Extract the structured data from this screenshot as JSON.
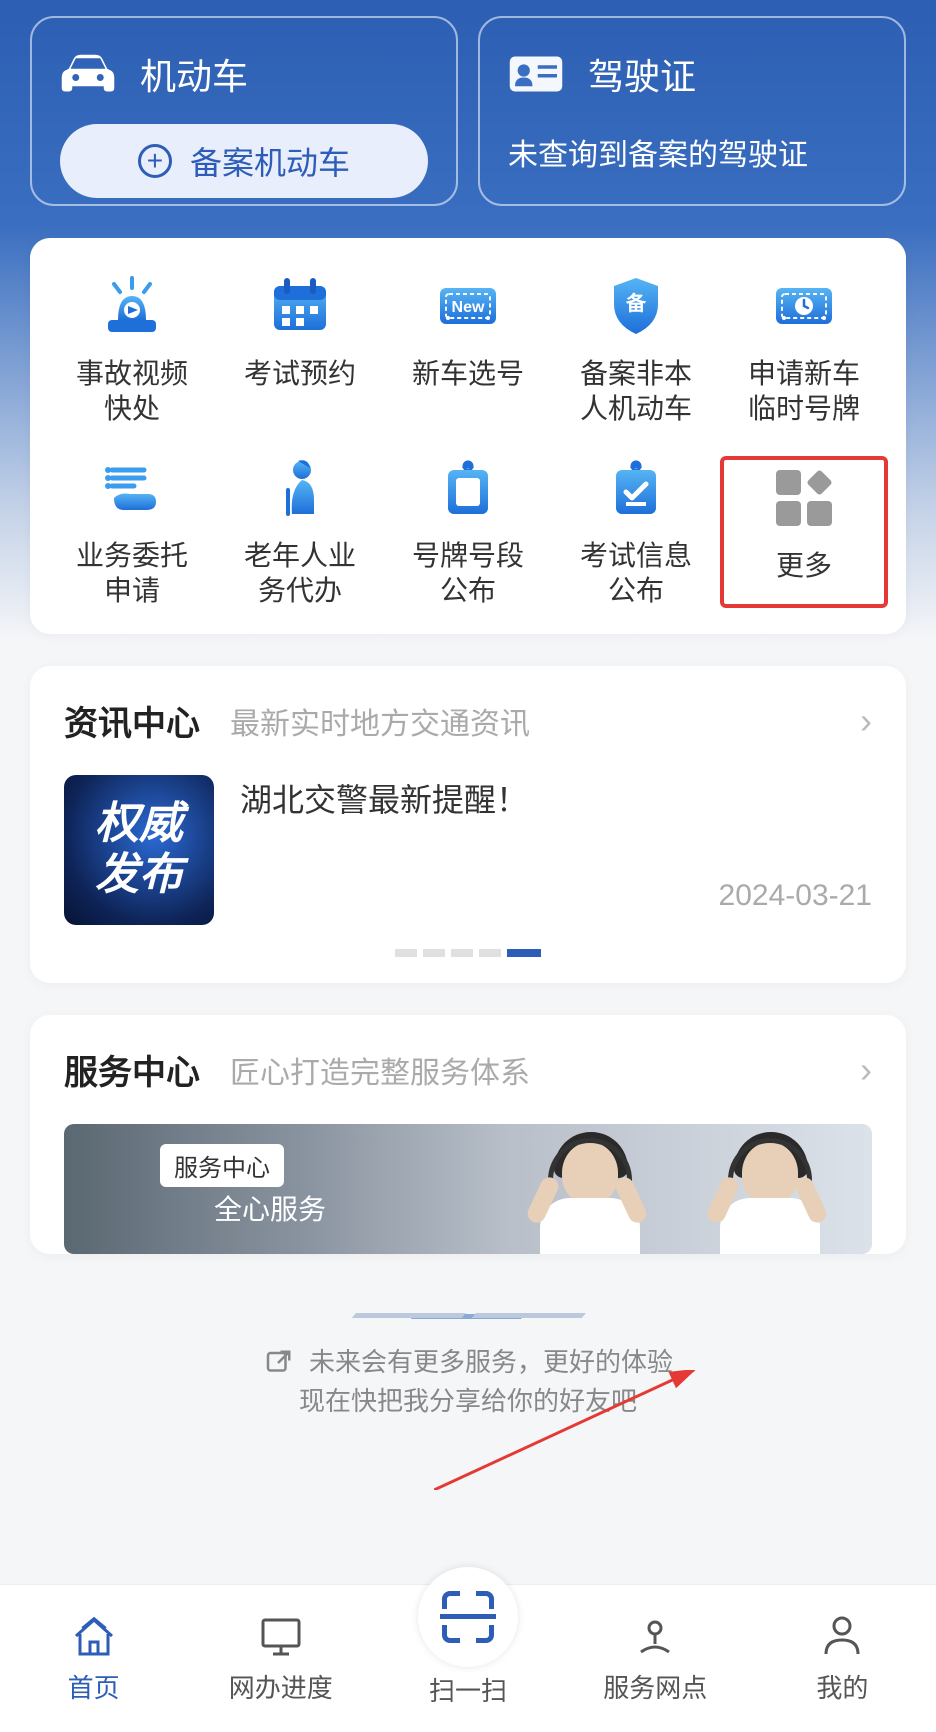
{
  "hero": {
    "vehicle": {
      "title": "机动车",
      "button": "备案机动车"
    },
    "license": {
      "title": "驾驶证",
      "subtitle": "未查询到备案的驾驶证"
    }
  },
  "grid": {
    "items": [
      {
        "name": "accident-video",
        "label": "事故视频\n快处"
      },
      {
        "name": "exam-book",
        "label": "考试预约"
      },
      {
        "name": "new-car-number",
        "label": "新车选号"
      },
      {
        "name": "register-other",
        "label": "备案非本\n人机动车"
      },
      {
        "name": "temp-plate",
        "label": "申请新车\n临时号牌"
      },
      {
        "name": "delegate",
        "label": "业务委托\n申请"
      },
      {
        "name": "elderly",
        "label": "老年人业\n务代办"
      },
      {
        "name": "plate-publish",
        "label": "号牌号段\n公布"
      },
      {
        "name": "exam-info",
        "label": "考试信息\n公布"
      },
      {
        "name": "more",
        "label": "更多"
      }
    ]
  },
  "news": {
    "title": "资讯中心",
    "subtitle": "最新实时地方交通资讯",
    "thumb_line1": "权威",
    "thumb_line2": "发布",
    "headline": "湖北交警最新提醒！",
    "date": "2024-03-21"
  },
  "service": {
    "title": "服务中心",
    "subtitle": "匠心打造完整服务体系",
    "tag": "服务中心",
    "slogan": "全心服务"
  },
  "teaser": {
    "line1": "未来会有更多服务，更好的体验",
    "line2": "现在快把我分享给你的好友吧"
  },
  "tabbar": {
    "home": "首页",
    "progress": "网办进度",
    "scan": "扫一扫",
    "branches": "服务网点",
    "mine": "我的"
  }
}
